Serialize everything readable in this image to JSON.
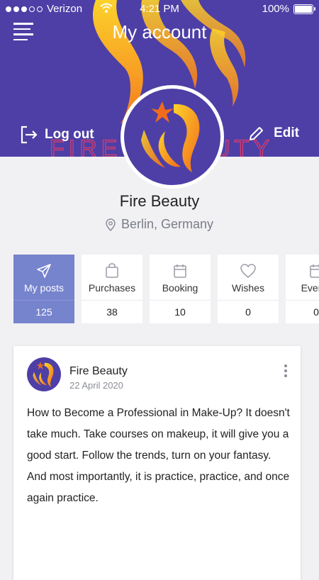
{
  "status_bar": {
    "carrier": "Verizon",
    "time": "4:21 PM",
    "battery": "100%",
    "icons": [
      "signal-dots",
      "wifi-icon",
      "battery-icon"
    ]
  },
  "header": {
    "title": "My account",
    "logout_label": "Log out",
    "edit_label": "Edit",
    "background_color": "#4d3fa6",
    "icons": [
      "menu-icon",
      "logout-icon",
      "edit-pencil-icon"
    ],
    "logo_text": "FIRE BEAUTY"
  },
  "profile": {
    "name": "Fire Beauty",
    "location": "Berlin, Germany",
    "location_icon": "location-pin-icon"
  },
  "tabs": [
    {
      "label": "My posts",
      "count": "125",
      "icon": "send-icon",
      "active": true
    },
    {
      "label": "Purchases",
      "count": "38",
      "icon": "bag-icon",
      "active": false
    },
    {
      "label": "Booking",
      "count": "10",
      "icon": "calendar-icon",
      "active": false
    },
    {
      "label": "Wishes",
      "count": "0",
      "icon": "heart-icon",
      "active": false
    },
    {
      "label": "Events",
      "count": "0",
      "icon": "calendar-icon",
      "active": false
    }
  ],
  "post": {
    "author": "Fire Beauty",
    "date": "22 April 2020",
    "text": "How to Become a Professional in Make-Up? It doesn't take much. Take courses on makeup, it will give you a good start. Follow the trends, turn on your fantasy. And most importantly, it is practice, practice, and once again practice.",
    "more_icon": "more-vertical-icon"
  },
  "colors": {
    "accent": "#7683cd",
    "brand": "#4d3fa6",
    "flame_orange": "#f7931e",
    "flame_yellow": "#fcd22a"
  }
}
